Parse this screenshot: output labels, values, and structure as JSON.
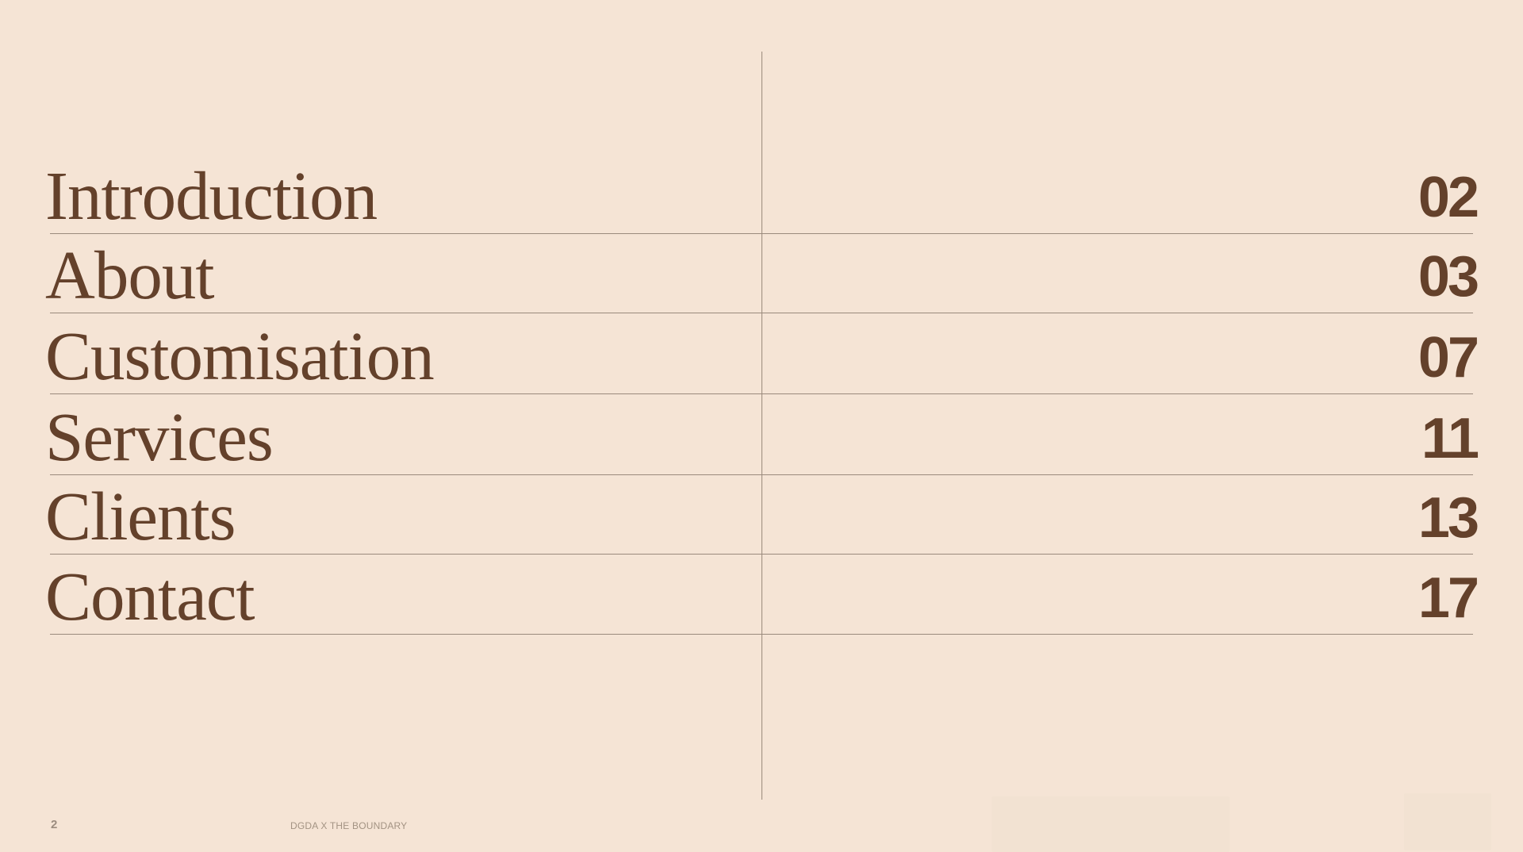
{
  "toc": {
    "items": [
      {
        "label": "Introduction",
        "page": "02"
      },
      {
        "label": "About",
        "page": "03"
      },
      {
        "label": "Customisation",
        "page": "07"
      },
      {
        "label": "Services",
        "page": "11"
      },
      {
        "label": "Clients",
        "page": "13"
      },
      {
        "label": "Contact",
        "page": "17"
      }
    ]
  },
  "footer": {
    "page_number": "2",
    "title": "DGDA X THE BOUNDARY"
  },
  "colors": {
    "background": "#f5e4d5",
    "text": "#64412b",
    "rule": "#9a8a7c",
    "footer_text": "#9b8c7f"
  }
}
